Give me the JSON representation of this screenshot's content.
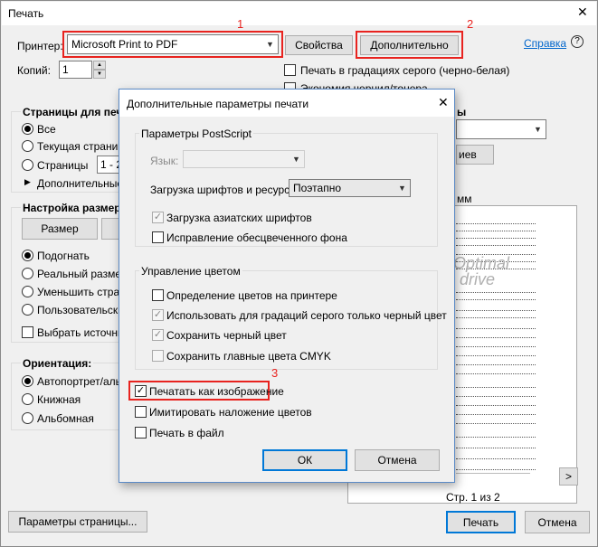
{
  "window": {
    "title": "Печать",
    "close_glyph": "✕"
  },
  "printer": {
    "label": "Принтер:",
    "value": "Microsoft Print to PDF",
    "properties_button": "Свойства",
    "advanced_button": "Дополнительно",
    "help_link": "Справка",
    "help_icon": "?"
  },
  "copies": {
    "label": "Копий:",
    "value": "1"
  },
  "options": {
    "grayscale": "Печать в градациях серого (черно-белая)",
    "ink_saving": "Экономия чернил/тонера"
  },
  "pages": {
    "title": "Страницы для печат",
    "all": "Все",
    "current": "Текущая страница",
    "pages": "Страницы",
    "pages_value": "1 - 2",
    "more": "Дополнительные п"
  },
  "sizing": {
    "title": "Настройка размера и",
    "size_button": "Размер",
    "fit": "Подогнать",
    "actual": "Реальный размер",
    "shrink": "Уменьшить страниц",
    "custom": "Пользовательский м",
    "source": "Выбрать источник б"
  },
  "orientation": {
    "title": "Ориентация:",
    "auto": "Автопортрет/альбо",
    "portrait": "Книжная",
    "landscape": "Альбомная"
  },
  "right_panel": {
    "comments_fragment": "ы",
    "summary_fragment": "иев",
    "size_fragment": "мм",
    "next_button": ">",
    "page_counter": "Стр. 1 из 2"
  },
  "watermark": {
    "line1": "Optimal",
    "line2": "drive"
  },
  "bottom": {
    "page_setup_button": "Параметры страницы...",
    "print_button": "Печать",
    "cancel_button": "Отмена"
  },
  "dialog": {
    "title": "Дополнительные параметры печати",
    "close_glyph": "✕",
    "postscript_group": "Параметры PostScript",
    "language_label": "Язык:",
    "font_download_label": "Загрузка шрифтов и ресурсов:",
    "font_download_value": "Поэтапно",
    "asian_fonts": "Загрузка азиатских шрифтов",
    "fix_background": "Исправление обесцвеченного фона",
    "color_group": "Управление цветом",
    "printer_color": "Определение цветов на принтере",
    "black_for_gray": "Использовать для градаций серого только черный цвет",
    "keep_black": "Сохранить черный цвет",
    "keep_cmyk": "Сохранить главные цвета CMYK",
    "print_as_image": "Печатать как изображение",
    "simulate_overprint": "Имитировать наложение цветов",
    "print_to_file": "Печать в файл",
    "ok_button": "ОК",
    "cancel_button": "Отмена"
  },
  "markers": {
    "one": "1",
    "two": "2",
    "three": "3"
  },
  "colors": {
    "accent_red": "#e8231f",
    "link_blue": "#0066cc",
    "focus_blue": "#0078d7"
  }
}
